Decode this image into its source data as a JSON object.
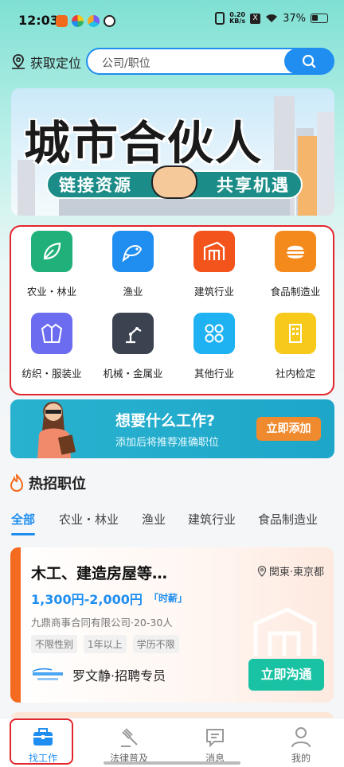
{
  "status_bar": {
    "time": "12:03",
    "net_speed": "0.20",
    "net_unit": "KB/s",
    "battery": "37%"
  },
  "header": {
    "location_label": "获取定位",
    "search_placeholder": "公司/职位"
  },
  "banner": {
    "title": "城市合伙人",
    "sub_left": "链接资源",
    "sub_right": "共享机遇"
  },
  "categories": [
    {
      "label": "农业・林业",
      "icon": "leaf-icon",
      "color": "#20b07a"
    },
    {
      "label": "渔业",
      "icon": "fish-icon",
      "color": "#1f8ef0"
    },
    {
      "label": "建筑行业",
      "icon": "building-icon",
      "color": "#f2541c"
    },
    {
      "label": "食品制造业",
      "icon": "burger-icon",
      "color": "#f58a1c"
    },
    {
      "label": "纺织・服装业",
      "icon": "jacket-icon",
      "color": "#6b6cf0"
    },
    {
      "label": "机械・金属业",
      "icon": "robot-arm-icon",
      "color": "#3b4250"
    },
    {
      "label": "其他行业",
      "icon": "grid-icon",
      "color": "#1fb2f2"
    },
    {
      "label": "社内检定",
      "icon": "office-icon",
      "color": "#f7c91a"
    }
  ],
  "promo": {
    "title": "想要什么工作?",
    "subtitle": "添加后将推荐准确职位",
    "button": "立即添加"
  },
  "hot_jobs": {
    "title": "热招职位",
    "tabs": [
      "全部",
      "农业・林业",
      "渔业",
      "建筑行业",
      "食品制造业"
    ]
  },
  "job_card": {
    "title": "木工、建造房屋等…",
    "location": "関東·東京都",
    "salary": "1,300円-2,000円",
    "wage_type": "「时薪」",
    "company": "九鼎商事合同有限公司·20-30人",
    "tags": [
      "不限性别",
      "1年以上",
      "学历不限"
    ],
    "recruiter": "罗文静·招聘专员",
    "chat_button": "立即沟通"
  },
  "bottom_nav": [
    {
      "label": "找工作",
      "icon": "briefcase-icon"
    },
    {
      "label": "法律普及",
      "icon": "gavel-icon"
    },
    {
      "label": "消息",
      "icon": "message-icon"
    },
    {
      "label": "我的",
      "icon": "user-icon"
    }
  ],
  "colors": {
    "accent": "#1f8ef0",
    "highlight": "#e3262b",
    "chat": "#18c2a3",
    "stripe": "#f46a1e"
  }
}
